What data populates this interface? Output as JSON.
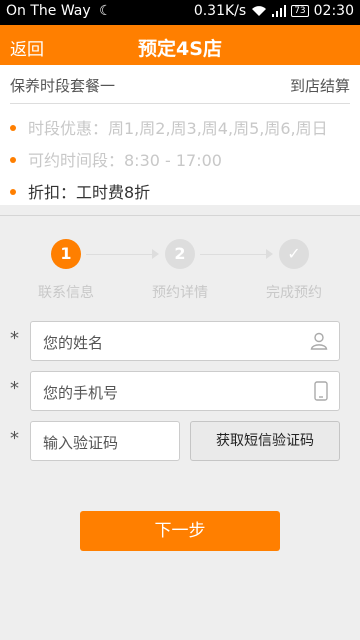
{
  "status_bar": {
    "carrier": "On The Way",
    "speed": "0.31K/s",
    "battery": "73",
    "time": "02:30"
  },
  "header": {
    "back_label": "返回",
    "title": "预定4S店"
  },
  "plan": {
    "name": "保养时段套餐一",
    "payment": "到店结算"
  },
  "info_items": [
    {
      "text": "时段优惠：周1,周2,周3,周4,周5,周6,周日"
    },
    {
      "text": "可约时间段：8:30 - 17:00"
    },
    {
      "text": "折扣：工时费8折"
    }
  ],
  "steps": [
    {
      "number": "1",
      "label": "联系信息",
      "active": true
    },
    {
      "number": "2",
      "label": "预约详情",
      "active": false
    },
    {
      "number": "✓",
      "label": "完成预约",
      "active": false
    }
  ],
  "form": {
    "required_mark": "*",
    "name_placeholder": "您的姓名",
    "phone_placeholder": "您的手机号",
    "code_placeholder": "输入验证码",
    "get_code_label": "获取短信验证码"
  },
  "next_label": "下一步",
  "colors": {
    "accent": "#ff7f00",
    "inactive": "#dddddd"
  }
}
